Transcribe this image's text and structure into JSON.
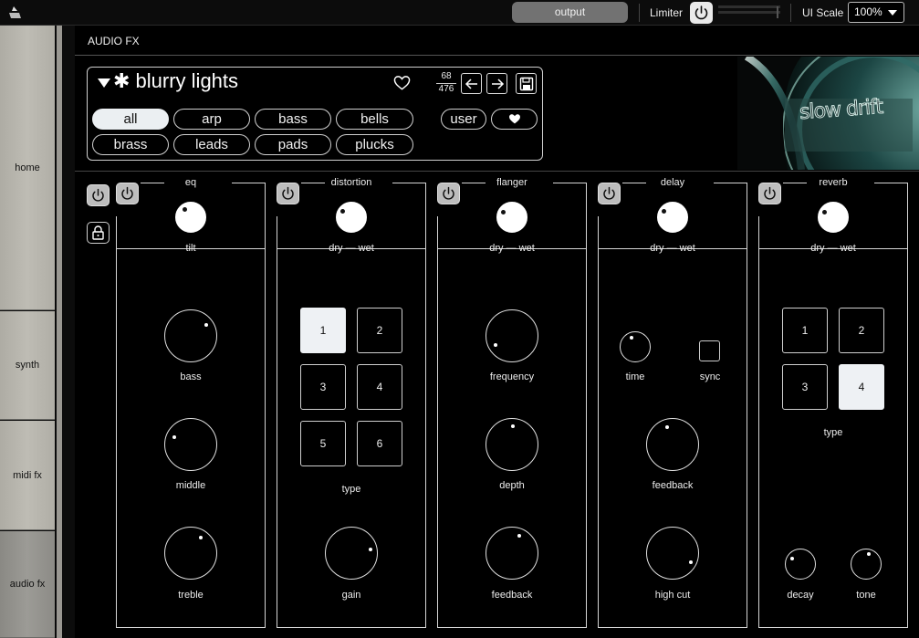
{
  "topbar": {
    "output_label": "output",
    "limiter_label": "Limiter",
    "ui_scale_label": "UI Scale",
    "ui_scale_value": "100%"
  },
  "sidebar": {
    "items": [
      {
        "label": "home",
        "active": false
      },
      {
        "label": "synth",
        "active": false
      },
      {
        "label": "midi fx",
        "active": false
      },
      {
        "label": "audio fx",
        "active": true
      }
    ]
  },
  "page": {
    "title": "AUDIO FX"
  },
  "preset": {
    "name": "✱ blurry lights",
    "index": "68",
    "total": "476",
    "art_text": "slow drift",
    "categories": [
      "all",
      "arp",
      "bass",
      "bells",
      "brass",
      "leads",
      "pads",
      "plucks"
    ],
    "selected_category": "all",
    "user_label": "user"
  },
  "modules": {
    "eq": {
      "title": "eq",
      "mix_label": "tilt",
      "knobs": {
        "bass": "bass",
        "middle": "middle",
        "treble": "treble"
      }
    },
    "distortion": {
      "title": "distortion",
      "mix_label": "dry — wet",
      "types": [
        "1",
        "2",
        "3",
        "4",
        "5",
        "6"
      ],
      "selected_type": "1",
      "type_label": "type",
      "gain_label": "gain"
    },
    "flanger": {
      "title": "flanger",
      "mix_label": "dry — wet",
      "frequency_label": "frequency",
      "depth_label": "depth",
      "feedback_label": "feedback"
    },
    "delay": {
      "title": "delay",
      "mix_label": "dry — wet",
      "time_label": "time",
      "sync_label": "sync",
      "feedback_label": "feedback",
      "highcut_label": "high cut"
    },
    "reverb": {
      "title": "reverb",
      "mix_label": "dry — wet",
      "types": [
        "1",
        "2",
        "3",
        "4"
      ],
      "selected_type": "4",
      "type_label": "type",
      "decay_label": "decay",
      "tone_label": "tone"
    }
  },
  "colors": {
    "background": "#000000",
    "accent": "#ebeff2",
    "sidebar": "#b8b6ae"
  }
}
